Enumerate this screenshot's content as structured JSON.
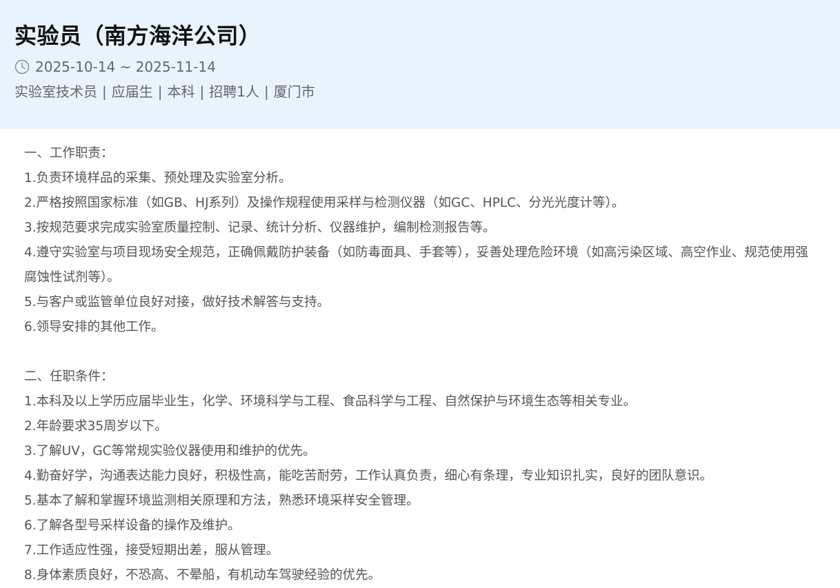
{
  "job": {
    "title": "实验员（南方海洋公司）",
    "date_range": "2025-10-14 ~ 2025-11-14",
    "meta": [
      "实验室技术员",
      "应届生",
      "本科",
      "招聘1人",
      "厦门市"
    ],
    "meta_separator": "|"
  },
  "icons": {
    "clock": "clock-icon"
  },
  "colors": {
    "header_bg": "#e8f3fe",
    "title": "#111111",
    "body_text": "#555555"
  },
  "description": {
    "duties_heading": "一、工作职责：",
    "duties": [
      "1.负责环境样品的采集、预处理及实验室分析。",
      "2.严格按照国家标准（如GB、HJ系列）及操作规程使用采样与检测仪器（如GC、HPLC、分光光度计等）。",
      "3.按规范要求完成实验室质量控制、记录、统计分析、仪器维护，编制检测报告等。",
      "4.遵守实验室与项目现场安全规范，正确佩戴防护装备（如防毒面具、手套等），妥善处理危险环境（如高污染区域、高空作业、规范使用强腐蚀性试剂等）。",
      "5.与客户或监管单位良好对接，做好技术解答与支持。",
      "6.领导安排的其他工作。"
    ],
    "requirements_heading": "二、任职条件：",
    "requirements": [
      "1.本科及以上学历应届毕业生，化学、环境科学与工程、食品科学与工程、自然保护与环境生态等相关专业。",
      "2.年龄要求35周岁以下。",
      "3.了解UV，GC等常规实验仪器使用和维护的优先。",
      "4.勤奋好学，沟通表达能力良好，积极性高，能吃苦耐劳，工作认真负责，细心有条理，专业知识扎实，良好的团队意识。",
      "5.基本了解和掌握环境监测相关原理和方法，熟悉环境采样安全管理。",
      "6.了解各型号采样设备的操作及维护。",
      "7.工作适应性强，接受短期出差，服从管理。",
      "8.身体素质良好，不恐高、不晕船，有机动车驾驶经验的优先。"
    ]
  }
}
